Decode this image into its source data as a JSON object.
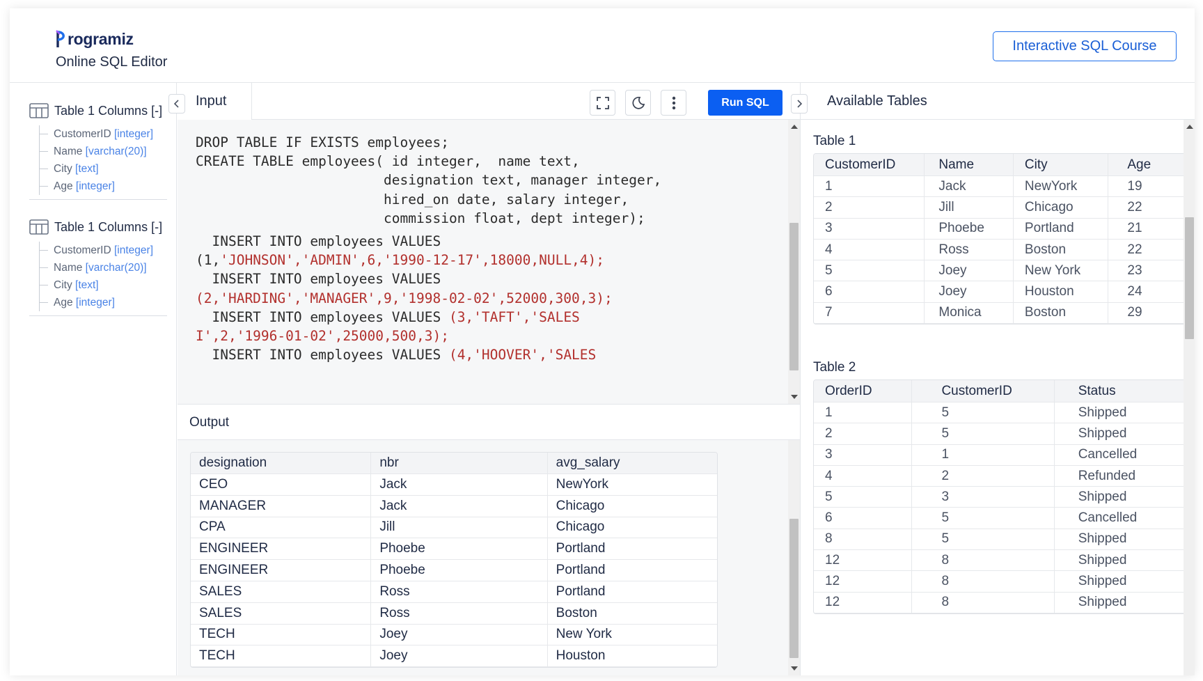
{
  "header": {
    "logo_text": "rogramiz",
    "subtitle": "Online SQL Editor",
    "course_button": "Interactive SQL Course"
  },
  "sidebar": {
    "groups": [
      {
        "title": "Table 1 Columns [-]",
        "columns": [
          {
            "name": "CustomerID",
            "type": "[integer]"
          },
          {
            "name": "Name",
            "type": "[varchar(20)]"
          },
          {
            "name": "City",
            "type": "[text]"
          },
          {
            "name": "Age",
            "type": "[integer]"
          }
        ]
      },
      {
        "title": "Table 1 Columns [-]",
        "columns": [
          {
            "name": "CustomerID",
            "type": "[integer]"
          },
          {
            "name": "Name",
            "type": "[varchar(20)]"
          },
          {
            "name": "City",
            "type": "[text]"
          },
          {
            "name": "Age",
            "type": "[integer]"
          }
        ]
      }
    ]
  },
  "editor": {
    "tab_label": "Input",
    "run_button": "Run SQL",
    "lines": [
      [
        {
          "t": "DROP TABLE IF EXISTS employees;"
        }
      ],
      [
        {
          "t": "CREATE TABLE employees( id integer,  name text,"
        }
      ],
      [
        {
          "t": "                       designation text, manager integer,"
        }
      ],
      [
        {
          "t": "                       hired_on date, salary integer,"
        }
      ],
      [
        {
          "t": "                       commission float, dept integer);"
        }
      ],
      [
        {
          "t": "  INSERT INTO employees VALUES",
          "gap": true
        }
      ],
      [
        {
          "t": "(1,"
        },
        {
          "t": "'JOHNSON','ADMIN',6,'1990-12-17',18000,NULL,4);",
          "s": true
        }
      ],
      [
        {
          "t": "  INSERT INTO employees VALUES"
        }
      ],
      [
        {
          "t": "(2,'HARDING','MANAGER',9,'1998-02-02',52000,300,3);",
          "s": true
        }
      ],
      [
        {
          "t": "  INSERT INTO employees VALUES "
        },
        {
          "t": "(3,'TAFT','SALES",
          "s": true
        }
      ],
      [
        {
          "t": "I',2,'1996-01-02',25000,500,3);",
          "s": true
        }
      ],
      [
        {
          "t": "  INSERT INTO employees VALUES "
        },
        {
          "t": "(4,'HOOVER','SALES",
          "s": true
        }
      ]
    ]
  },
  "output": {
    "title": "Output",
    "columns": [
      "designation",
      "nbr",
      "avg_salary"
    ],
    "rows": [
      [
        "CEO",
        "Jack",
        "NewYork"
      ],
      [
        "MANAGER",
        "Jack",
        "Chicago"
      ],
      [
        "CPA",
        "Jill",
        "Chicago"
      ],
      [
        "ENGINEER",
        "Phoebe",
        "Portland"
      ],
      [
        "ENGINEER",
        "Phoebe",
        "Portland"
      ],
      [
        "SALES",
        "Ross",
        "Portland"
      ],
      [
        "SALES",
        "Ross",
        "Boston"
      ],
      [
        "TECH",
        "Joey",
        "New York"
      ],
      [
        "TECH",
        "Joey",
        "Houston"
      ]
    ]
  },
  "available": {
    "title": "Available Tables",
    "table1": {
      "title": "Table 1",
      "columns": [
        "CustomerID",
        "Name",
        "City",
        "Age"
      ],
      "rows": [
        [
          "1",
          "Jack",
          "NewYork",
          "19"
        ],
        [
          "2",
          "Jill",
          "Chicago",
          "22"
        ],
        [
          "3",
          "Phoebe",
          "Portland",
          "21"
        ],
        [
          "4",
          "Ross",
          "Boston",
          "22"
        ],
        [
          "5",
          "Joey",
          "New York",
          "23"
        ],
        [
          "6",
          "Joey",
          "Houston",
          "24"
        ],
        [
          "7",
          "Monica",
          "Boston",
          "29"
        ]
      ]
    },
    "table2": {
      "title": "Table 2",
      "columns": [
        "OrderID",
        "CustomerID",
        "Status"
      ],
      "rows": [
        [
          "1",
          "5",
          "Shipped"
        ],
        [
          "2",
          "5",
          "Shipped"
        ],
        [
          "3",
          "1",
          "Cancelled"
        ],
        [
          "4",
          "2",
          "Refunded"
        ],
        [
          "5",
          "3",
          "Shipped"
        ],
        [
          "6",
          "5",
          "Cancelled"
        ],
        [
          "8",
          "5",
          "Shipped"
        ],
        [
          "12",
          "8",
          "Shipped"
        ],
        [
          "12",
          "8",
          "Shipped"
        ],
        [
          "12",
          "8",
          "Shipped"
        ]
      ]
    }
  },
  "colors": {
    "brand_blue": "#0b5ff2",
    "code_string": "#b2302d",
    "type_blue": "#4a83e6"
  }
}
